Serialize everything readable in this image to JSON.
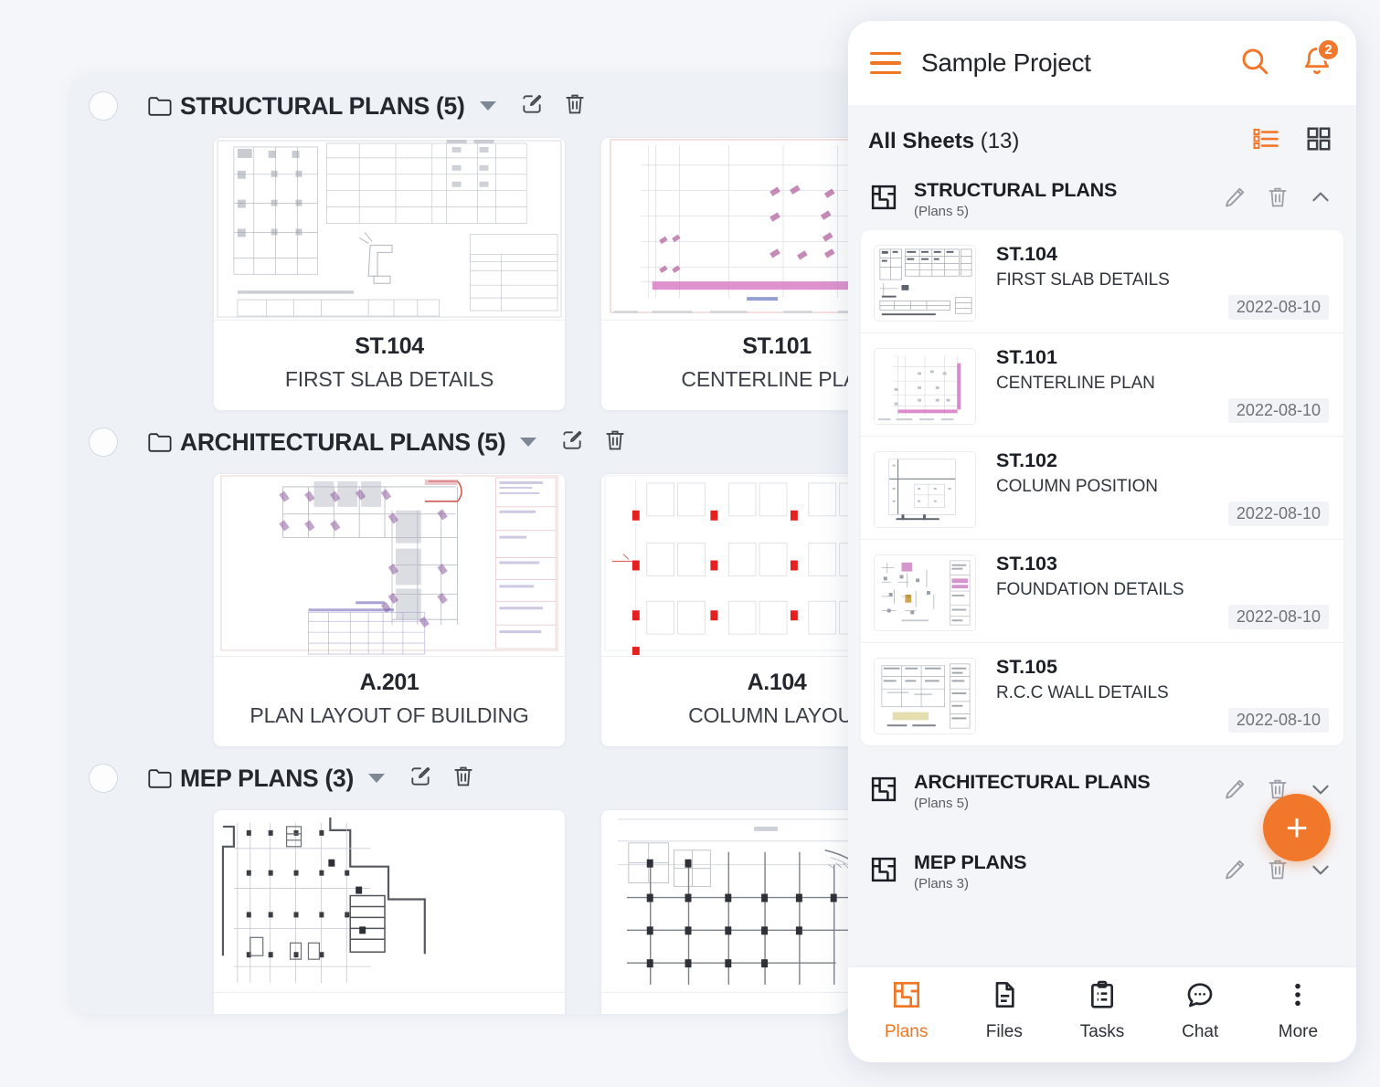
{
  "desktop": {
    "groups": [
      {
        "title": "STRUCTURAL PLANS (5)",
        "cards": [
          {
            "code": "ST.104",
            "name": "FIRST SLAB DETAILS",
            "thumb": "schedule-table"
          },
          {
            "code": "ST.101",
            "name": "CENTERLINE PLAN",
            "thumb": "pink-grid"
          }
        ]
      },
      {
        "title": "ARCHITECTURAL PLANS (5)",
        "cards": [
          {
            "code": "A.201",
            "name": "PLAN LAYOUT OF BUILDING",
            "thumb": "floorplan-color"
          },
          {
            "code": "A.104",
            "name": "COLUMN LAYOUT",
            "thumb": "column-grid"
          }
        ]
      },
      {
        "title": "MEP PLANS (3)",
        "cards": [
          {
            "code": "",
            "name": "",
            "thumb": "mep-left"
          },
          {
            "code": "",
            "name": "",
            "thumb": "mep-right"
          }
        ]
      }
    ]
  },
  "phone": {
    "appbar": {
      "title": "Sample Project",
      "menu_icon": "hamburger-menu-icon",
      "search_icon": "search-icon",
      "notification_icon": "bell-icon",
      "notification_count": "2"
    },
    "subheader": {
      "label": "All Sheets",
      "count": "(13)",
      "list_view_icon": "list-view-icon",
      "grid_view_icon": "grid-view-icon",
      "active_view": "list"
    },
    "groups": [
      {
        "title": "STRUCTURAL PLANS",
        "subtitle": "(Plans 5)",
        "expanded": true,
        "chevron": "chevron-up-icon",
        "sheets": [
          {
            "code": "ST.104",
            "name": "FIRST SLAB DETAILS",
            "date": "2022-08-10",
            "thumb": "schedule-table"
          },
          {
            "code": "ST.101",
            "name": "CENTERLINE PLAN",
            "date": "2022-08-10",
            "thumb": "pink-grid"
          },
          {
            "code": "ST.102",
            "name": "COLUMN POSITION",
            "date": "2022-08-10",
            "thumb": "cross-axes"
          },
          {
            "code": "ST.103",
            "name": "FOUNDATION DETAILS",
            "date": "2022-08-10",
            "thumb": "foundation"
          },
          {
            "code": "ST.105",
            "name": "R.C.C WALL DETAILS",
            "date": "2022-08-10",
            "thumb": "wall-details"
          }
        ]
      },
      {
        "title": "ARCHITECTURAL PLANS",
        "subtitle": "(Plans 5)",
        "expanded": false,
        "chevron": "chevron-down-icon",
        "sheets": []
      },
      {
        "title": "MEP PLANS",
        "subtitle": "(Plans 3)",
        "expanded": false,
        "chevron": "chevron-down-icon",
        "sheets": []
      }
    ],
    "fab": {
      "label": "+",
      "icon": "plus-icon"
    },
    "bottom_nav": [
      {
        "label": "Plans",
        "icon": "plans-icon",
        "active": true
      },
      {
        "label": "Files",
        "icon": "file-icon",
        "active": false
      },
      {
        "label": "Tasks",
        "icon": "clipboard-icon",
        "active": false
      },
      {
        "label": "Chat",
        "icon": "chat-bubble-icon",
        "active": false
      },
      {
        "label": "More",
        "icon": "more-vertical-icon",
        "active": false
      }
    ]
  },
  "colors": {
    "accent": "#f1782b",
    "page_bg": "#f4f6fa",
    "panel_bg": "#eef2f7",
    "text": "#1b1e24"
  }
}
